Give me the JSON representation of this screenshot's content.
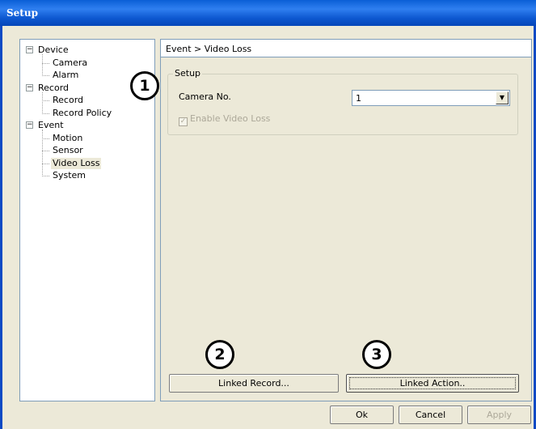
{
  "window": {
    "title": "Setup"
  },
  "tree": {
    "items": [
      {
        "label": "Device",
        "level": 0,
        "expander": "−"
      },
      {
        "label": "Camera",
        "level": 1
      },
      {
        "label": "Alarm",
        "level": 1
      },
      {
        "label": "Record",
        "level": 0,
        "expander": "−"
      },
      {
        "label": "Record",
        "level": 1
      },
      {
        "label": "Record Policy",
        "level": 1
      },
      {
        "label": "Event",
        "level": 0,
        "expander": "−"
      },
      {
        "label": "Motion",
        "level": 1
      },
      {
        "label": "Sensor",
        "level": 1
      },
      {
        "label": "Video Loss",
        "level": 1,
        "selected": true
      },
      {
        "label": "System",
        "level": 1
      }
    ]
  },
  "content": {
    "breadcrumb": "Event > Video Loss",
    "group_title": "Setup",
    "camera_label": "Camera No.",
    "camera_value": "1",
    "enable_label": "Enable Video Loss",
    "enable_checked": true,
    "linked_record_label": "Linked Record...",
    "linked_action_label": "Linked Action.."
  },
  "footer": {
    "ok_label": "Ok",
    "cancel_label": "Cancel",
    "apply_label": "Apply"
  },
  "callouts": {
    "one": "1",
    "two": "2",
    "three": "3"
  }
}
